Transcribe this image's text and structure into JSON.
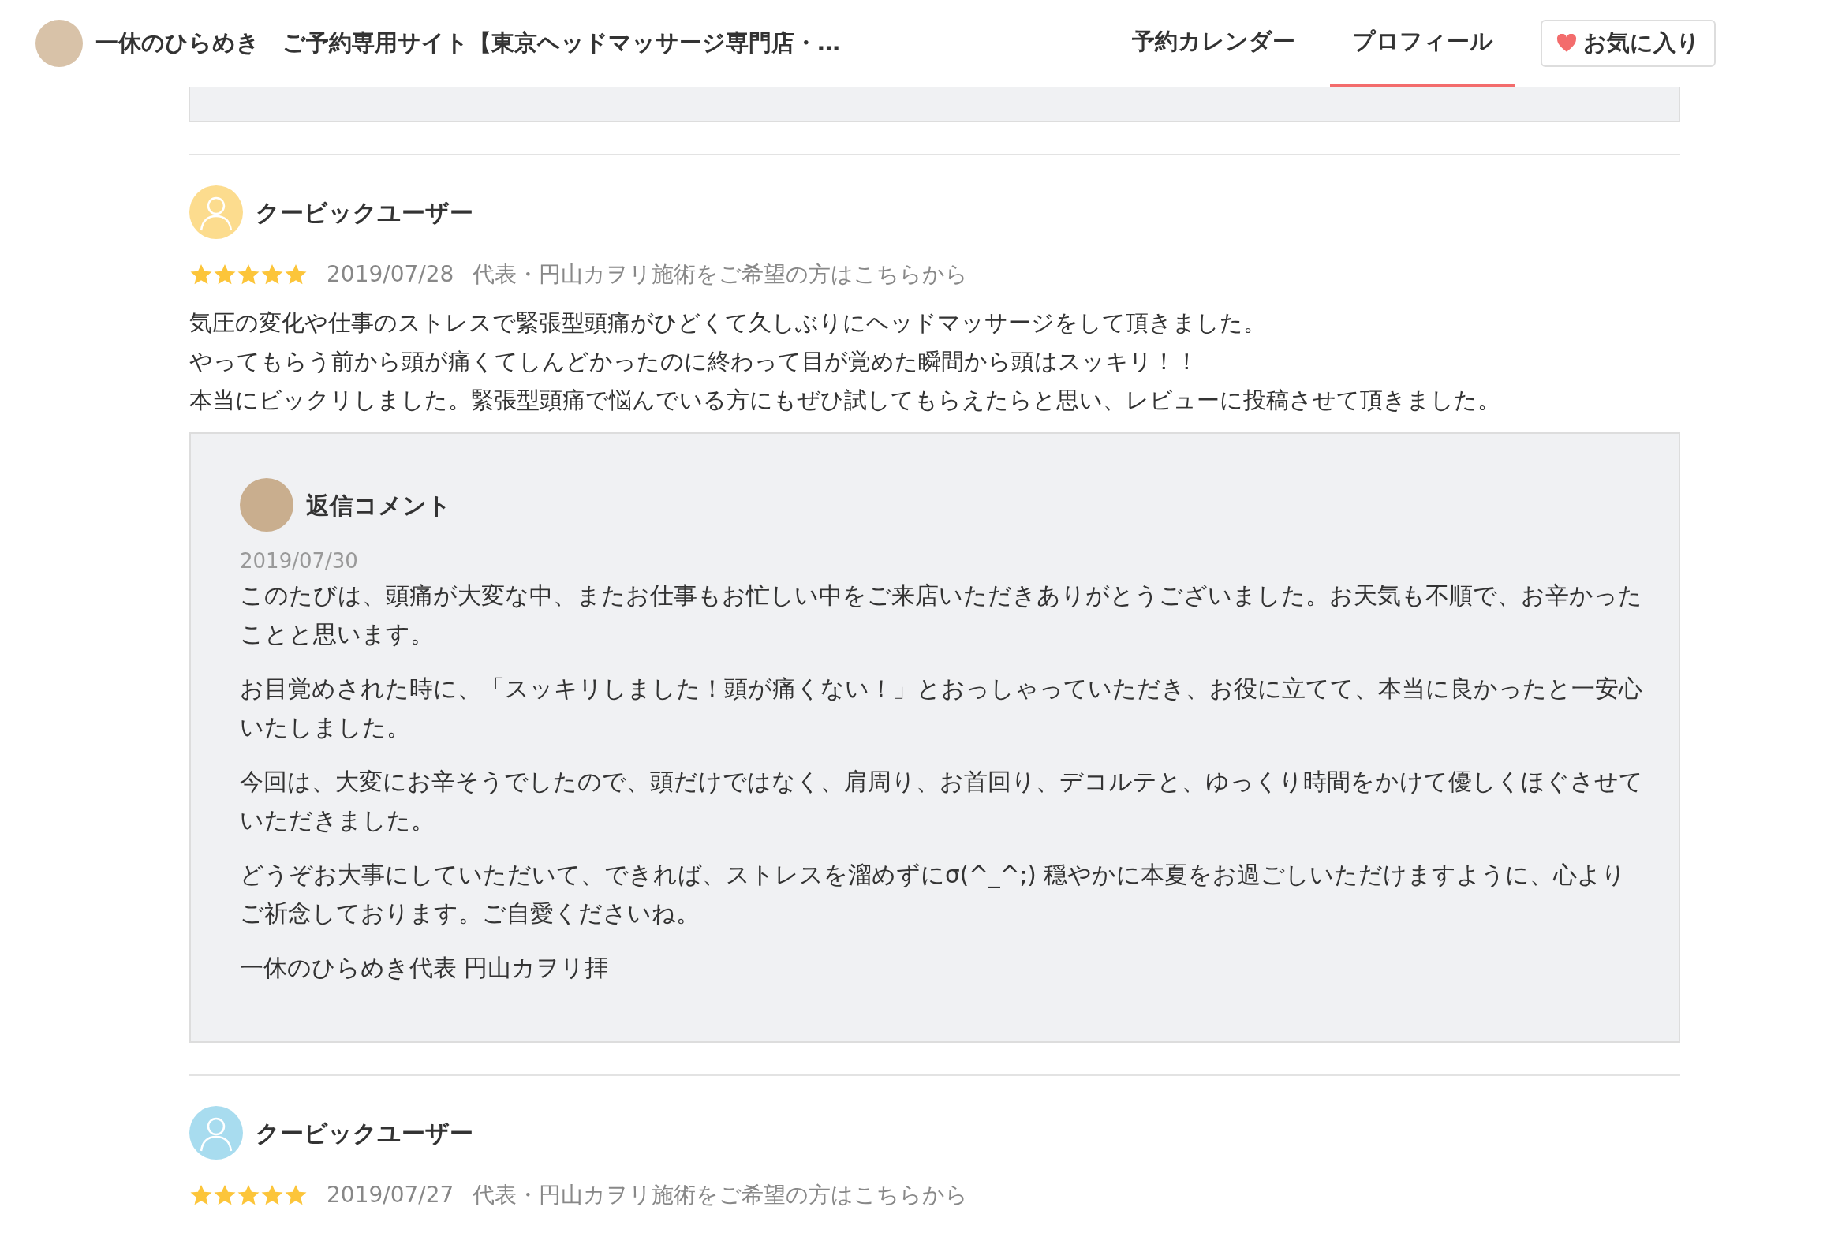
{
  "header": {
    "title": "一休のひらめき　ご予約専用サイト【東京ヘッドマッサージ専門店・…",
    "nav": [
      {
        "label": "予約カレンダー",
        "selected": false
      },
      {
        "label": "プロフィール",
        "selected": true
      }
    ],
    "favorite_button": {
      "label": "お気に入り"
    }
  },
  "reviews": [
    {
      "user": "クービックユーザー",
      "color": "#fcdc8e",
      "stars": 5,
      "date": "2019/07/28",
      "menu": "代表・円山カヲリ施術をご希望の方はこちらから",
      "body": [
        "気圧の変化や仕事のストレスで緊張型頭痛がひどくて久しぶりにヘッドマッサージをして頂きました。",
        "やってもらう前から頭が痛くてしんどかったのに終わって目が覚めた瞬間から頭はスッキリ！！",
        "本当にビックリしました。緊張型頭痛で悩んでいる方にもぜひ試してもらえたらと思い、レビューに投稿させて頂きました。"
      ],
      "reply": {
        "title": "返信コメント",
        "date": "2019/07/30",
        "paragraphs": [
          "このたびは、頭痛が大変な中、またお仕事もお忙しい中をご来店いただきありがとうございました。お天気も不順で、お辛かったことと思います。",
          "お目覚めされた時に、「スッキリしました！頭が痛くない！」とおっしゃっていただき、お役に立てて、本当に良かったと一安心いたしました。",
          "今回は、大変にお辛そうでしたので、頭だけではなく、肩周り、お首回り、デコルテと、ゆっくり時間をかけて優しくほぐさせていただきました。",
          "どうぞお大事にしていただいて、できれば、ストレスを溜めずにσ(^_^;) 穏やかに本夏をお過ごしいただけますように、心よりご祈念しております。ご自愛くださいね。",
          "一休のひらめき代表 円山カヲリ拝"
        ]
      }
    },
    {
      "user": "クービックユーザー",
      "color": "#a8dcef",
      "stars": 5,
      "date": "2019/07/27",
      "menu": "代表・円山カヲリ施術をご希望の方はこちらから"
    }
  ]
}
